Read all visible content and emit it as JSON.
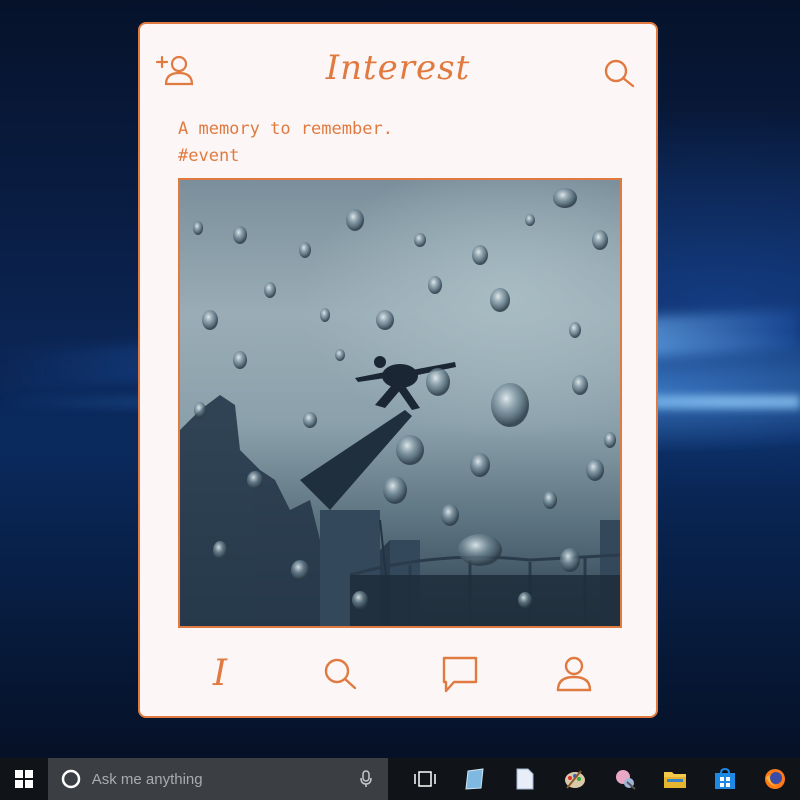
{
  "app": {
    "brand_title": "Interest",
    "header_icons": [
      "add-user-icon",
      "search-icon"
    ],
    "post": {
      "caption": "A memory to remember.",
      "hashtag": "#event"
    },
    "bottom_nav": {
      "home_glyph": "I",
      "icons": [
        "brand-home-icon",
        "search-icon",
        "comment-icon",
        "profile-icon"
      ]
    },
    "colors": {
      "accent": "#e07a40",
      "background": "#fcf7f6"
    }
  },
  "taskbar": {
    "search_placeholder": "Ask me anything",
    "icons": [
      "windows-start-icon",
      "cortana-icon",
      "microphone-icon",
      "task-view-icon",
      "app-icon-1",
      "document-icon",
      "paint-icon",
      "app-icon-2",
      "file-explorer-icon",
      "store-icon",
      "firefox-icon"
    ]
  }
}
